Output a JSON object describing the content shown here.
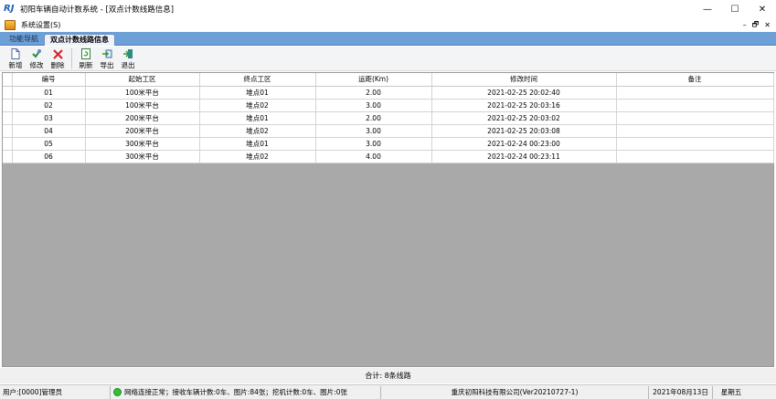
{
  "window": {
    "logo": "RJ",
    "title": "初阳车辆自动计数系统 - [双点计数线路信息]",
    "controls": [
      "—",
      "☐",
      "✕"
    ]
  },
  "menubar": {
    "menu_label": "系统设置(S)",
    "mdi_controls": [
      "–",
      "🗗",
      "✕"
    ]
  },
  "tabs": [
    {
      "label": "功能导航"
    },
    {
      "label": "双点计数线路信息"
    }
  ],
  "toolbar": {
    "buttons": [
      {
        "label": "新增",
        "icon": "new-doc-icon"
      },
      {
        "label": "修改",
        "icon": "edit-icon"
      },
      {
        "label": "删除",
        "icon": "delete-icon"
      },
      {
        "label": "刷新",
        "icon": "refresh-icon"
      },
      {
        "label": "导出",
        "icon": "export-icon"
      },
      {
        "label": "退出",
        "icon": "exit-icon"
      }
    ]
  },
  "table": {
    "headers": [
      "编号",
      "起始工区",
      "终点工区",
      "运距(Km)",
      "修改时间",
      "备注"
    ],
    "rows": [
      [
        "01",
        "100米平台",
        "堆点01",
        "2.00",
        "2021-02-25 20:02:40",
        ""
      ],
      [
        "02",
        "100米平台",
        "堆点02",
        "3.00",
        "2021-02-25 20:03:16",
        ""
      ],
      [
        "03",
        "200米平台",
        "堆点01",
        "2.00",
        "2021-02-25 20:03:02",
        ""
      ],
      [
        "04",
        "200米平台",
        "堆点02",
        "3.00",
        "2021-02-25 20:03:08",
        ""
      ],
      [
        "05",
        "300米平台",
        "堆点01",
        "3.00",
        "2021-02-24 00:23:00",
        ""
      ],
      [
        "06",
        "300米平台",
        "堆点02",
        "4.00",
        "2021-02-24 00:23:11",
        ""
      ]
    ]
  },
  "total_text": "合计:  8条线路",
  "status": {
    "user": "用户:[0000]管理员",
    "network": "网络连接正常；接收车辆计数:0车、图片:84张；挖机计数:0车、图片:0张",
    "network_ok_color": "#2fbf38",
    "company": "重庆初阳科技有限公司(Ver20210727-1)",
    "date": "2021年08月13日",
    "weekday": "星期五"
  }
}
